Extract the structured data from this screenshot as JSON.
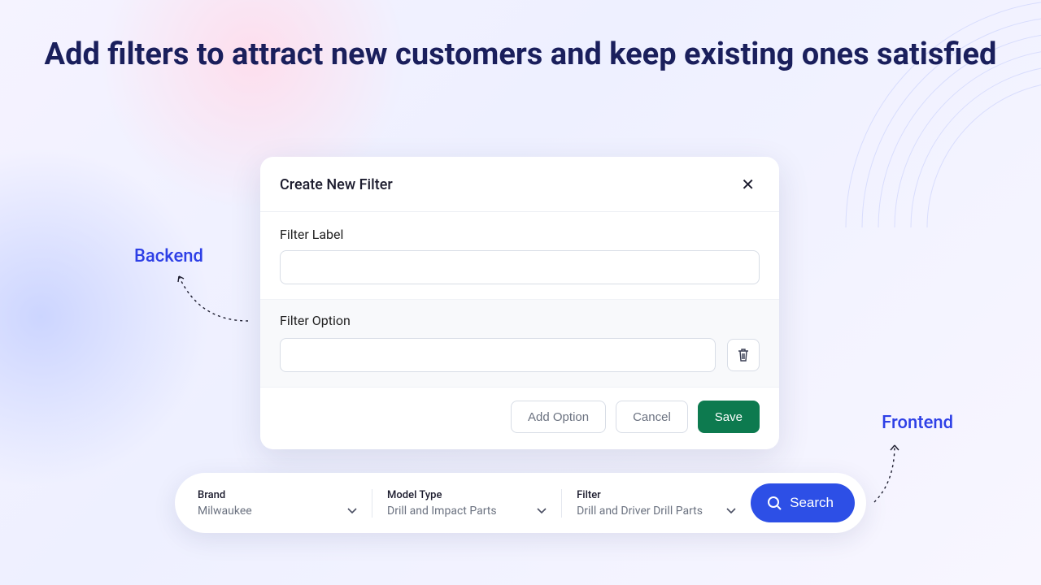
{
  "headline": "Add filters to attract new customers and keep existing ones satisfied",
  "annotations": {
    "backend": "Backend",
    "frontend": "Frontend"
  },
  "modal": {
    "title": "Create New Filter",
    "filter_label_heading": "Filter Label",
    "filter_label_value": "",
    "filter_option_heading": "Filter Option",
    "filter_option_value": "",
    "add_option_label": "Add Option",
    "cancel_label": "Cancel",
    "save_label": "Save"
  },
  "searchbar": {
    "segments": [
      {
        "label": "Brand",
        "value": "Milwaukee"
      },
      {
        "label": "Model Type",
        "value": "Drill and Impact Parts"
      },
      {
        "label": "Filter",
        "value": "Drill and Driver Drill Parts"
      }
    ],
    "search_label": "Search"
  },
  "colors": {
    "headline": "#1a1f5c",
    "accent_blue": "#2d4fe6",
    "accent_green": "#0d7a4f"
  }
}
